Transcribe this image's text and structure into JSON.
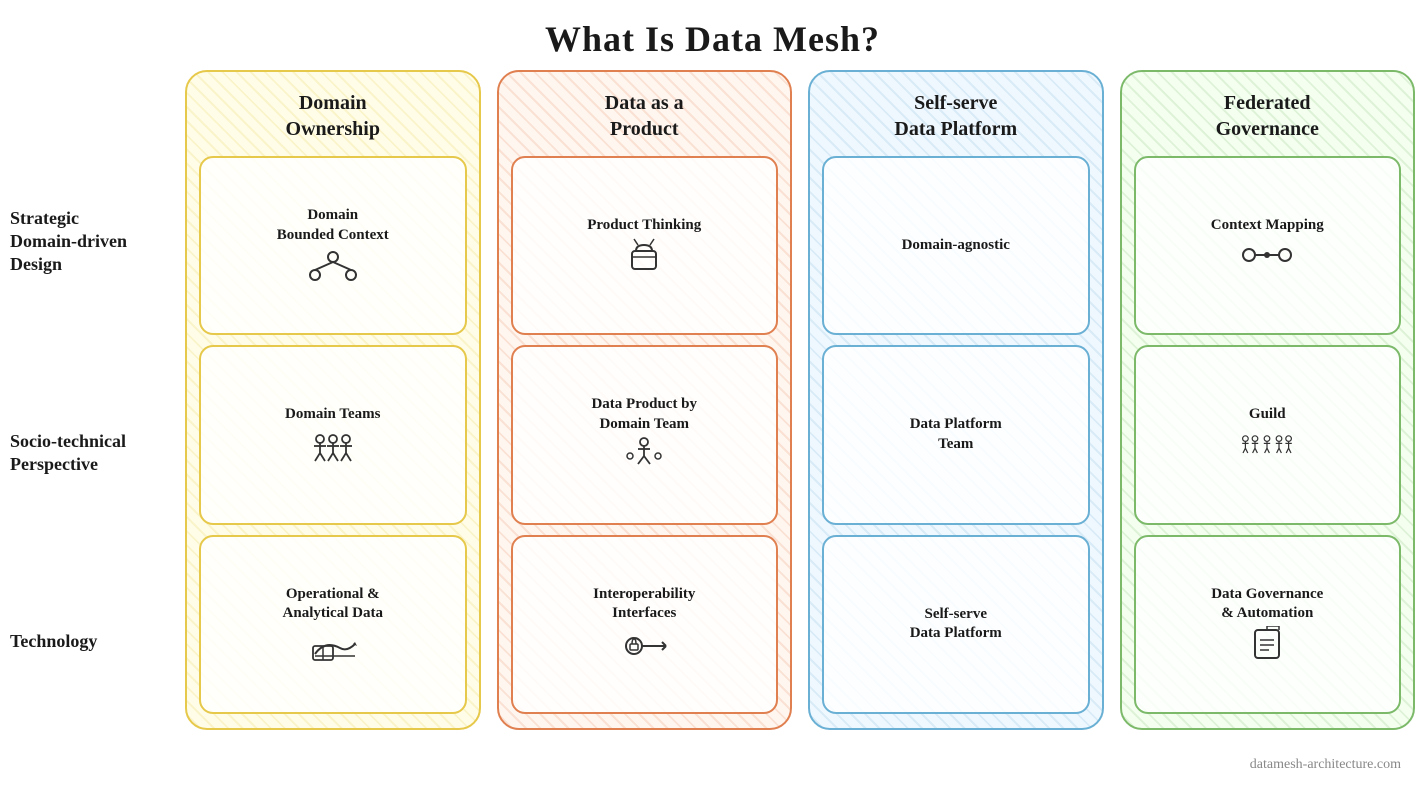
{
  "page": {
    "title": "What Is Data Mesh?",
    "footer": "datamesh-architecture.com"
  },
  "rowLabels": [
    {
      "id": "label-strategic",
      "text": "Strategic\nDomain-driven\nDesign"
    },
    {
      "id": "label-socio",
      "text": "Socio-technical\nPerspective"
    },
    {
      "id": "label-technology",
      "text": "Technology"
    }
  ],
  "pillars": [
    {
      "id": "domain-ownership",
      "title": "Domain\nOwnership",
      "colorClass": "pillar-yellow",
      "cardClass": "card-yellow",
      "cards": [
        {
          "id": "domain-bounded-context",
          "label": "Domain\nBounded Context",
          "icon": "network"
        },
        {
          "id": "domain-teams",
          "label": "Domain Teams",
          "icon": "people"
        },
        {
          "id": "operational-analytical",
          "label": "Operational &\nAnalytical Data",
          "icon": "book"
        }
      ]
    },
    {
      "id": "data-as-product",
      "title": "Data as a\nProduct",
      "colorClass": "pillar-orange",
      "cardClass": "card-orange",
      "cards": [
        {
          "id": "product-thinking",
          "label": "Product Thinking",
          "icon": "star"
        },
        {
          "id": "data-product-domain",
          "label": "Data Product by\nDomain Team",
          "icon": "team"
        },
        {
          "id": "interoperability",
          "label": "Interoperability\nInterfaces",
          "icon": "lock-connect"
        }
      ]
    },
    {
      "id": "self-serve-platform",
      "title": "Self-serve\nData Platform",
      "colorClass": "pillar-blue",
      "cardClass": "card-blue",
      "cards": [
        {
          "id": "domain-agnostic",
          "label": "Domain-agnostic",
          "icon": ""
        },
        {
          "id": "data-platform-team",
          "label": "Data Platform\nTeam",
          "icon": ""
        },
        {
          "id": "self-serve-platform-card",
          "label": "Self-serve\nData Platform",
          "icon": ""
        }
      ]
    },
    {
      "id": "federated-governance",
      "title": "Federated\nGovernance",
      "colorClass": "pillar-green",
      "cardClass": "card-green",
      "cards": [
        {
          "id": "context-mapping",
          "label": "Context Mapping",
          "icon": "nodes"
        },
        {
          "id": "guild",
          "label": "Guild",
          "icon": "guild-people"
        },
        {
          "id": "data-governance",
          "label": "Data Governance\n& Automation",
          "icon": "doc"
        }
      ]
    }
  ]
}
